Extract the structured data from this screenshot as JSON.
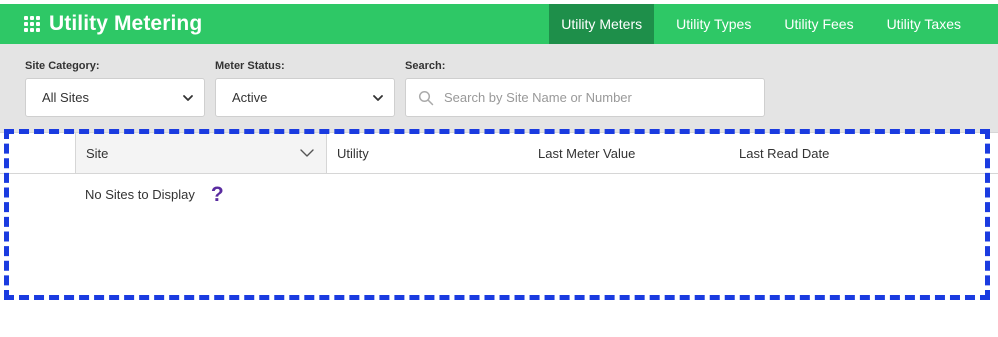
{
  "app": {
    "title": "Utility Metering",
    "icon": "grid-icon"
  },
  "nav": {
    "items": [
      {
        "label": "Utility Meters",
        "active": true
      },
      {
        "label": "Utility Types",
        "active": false
      },
      {
        "label": "Utility Fees",
        "active": false
      },
      {
        "label": "Utility Taxes",
        "active": false
      }
    ]
  },
  "filters": {
    "site_category": {
      "label": "Site Category:",
      "value": "All Sites"
    },
    "meter_status": {
      "label": "Meter Status:",
      "value": "Active"
    },
    "search": {
      "label": "Search:",
      "placeholder": "Search by Site Name or Number",
      "value": ""
    }
  },
  "table": {
    "columns": [
      "Site",
      "Utility",
      "Last Meter Value",
      "Last Read Date"
    ],
    "empty_message": "No Sites to Display",
    "help_glyph": "?"
  },
  "colors": {
    "header_green": "#2ec866",
    "active_nav": "#1e8f4a",
    "filter_bg": "#e4e4e4",
    "highlight_border": "#1a3be0",
    "help_icon": "#5a2ca0"
  }
}
